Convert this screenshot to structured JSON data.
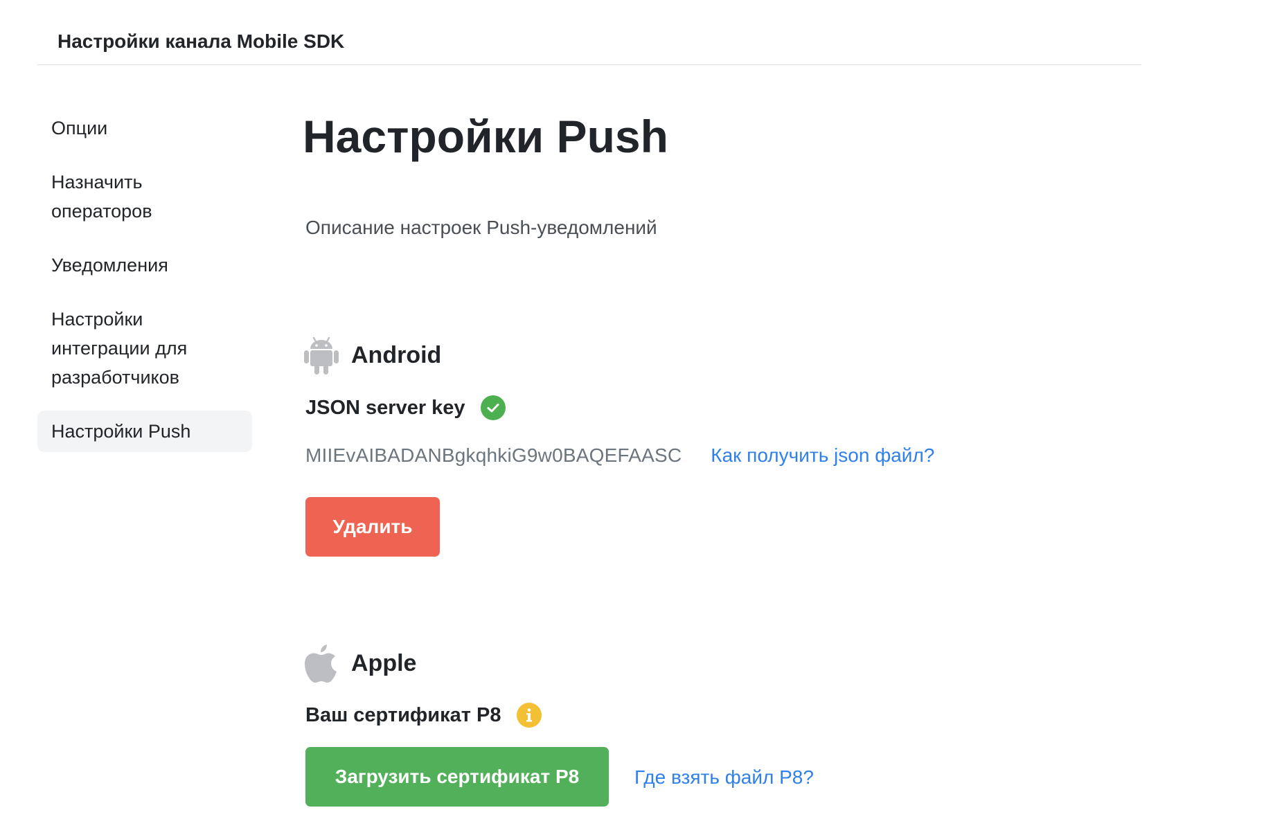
{
  "header": {
    "title": "Настройки канала Mobile SDK"
  },
  "sidebar": {
    "items": [
      {
        "label": "Опции",
        "active": false
      },
      {
        "label": "Назначить операторов",
        "active": false
      },
      {
        "label": "Уведомления",
        "active": false
      },
      {
        "label": "Настройки интеграции для разработчиков",
        "active": false
      },
      {
        "label": "Настройки Push",
        "active": true
      }
    ]
  },
  "main": {
    "title": "Настройки Push",
    "description": "Описание настроек Push-уведомлений",
    "android": {
      "title": "Android",
      "icon": "android-icon",
      "field_label": "JSON server key",
      "status_icon": "check-circle-icon",
      "status_color": "#4caf50",
      "key_value": "MIIEvAIBADANBgkqhkiG9w0BAQEFAASC",
      "help_link": "Как получить json файл?",
      "delete_button": "Удалить",
      "delete_color": "#ee6352"
    },
    "apple": {
      "title": "Apple",
      "icon": "apple-icon",
      "field_label": "Ваш сертификат P8",
      "info_icon": "info-circle-icon",
      "info_color": "#f3c035",
      "upload_button": "Загрузить сертификат P8",
      "upload_color": "#52b05a",
      "help_link": "Где взять файл P8?"
    },
    "link_color": "#2f80ed"
  }
}
